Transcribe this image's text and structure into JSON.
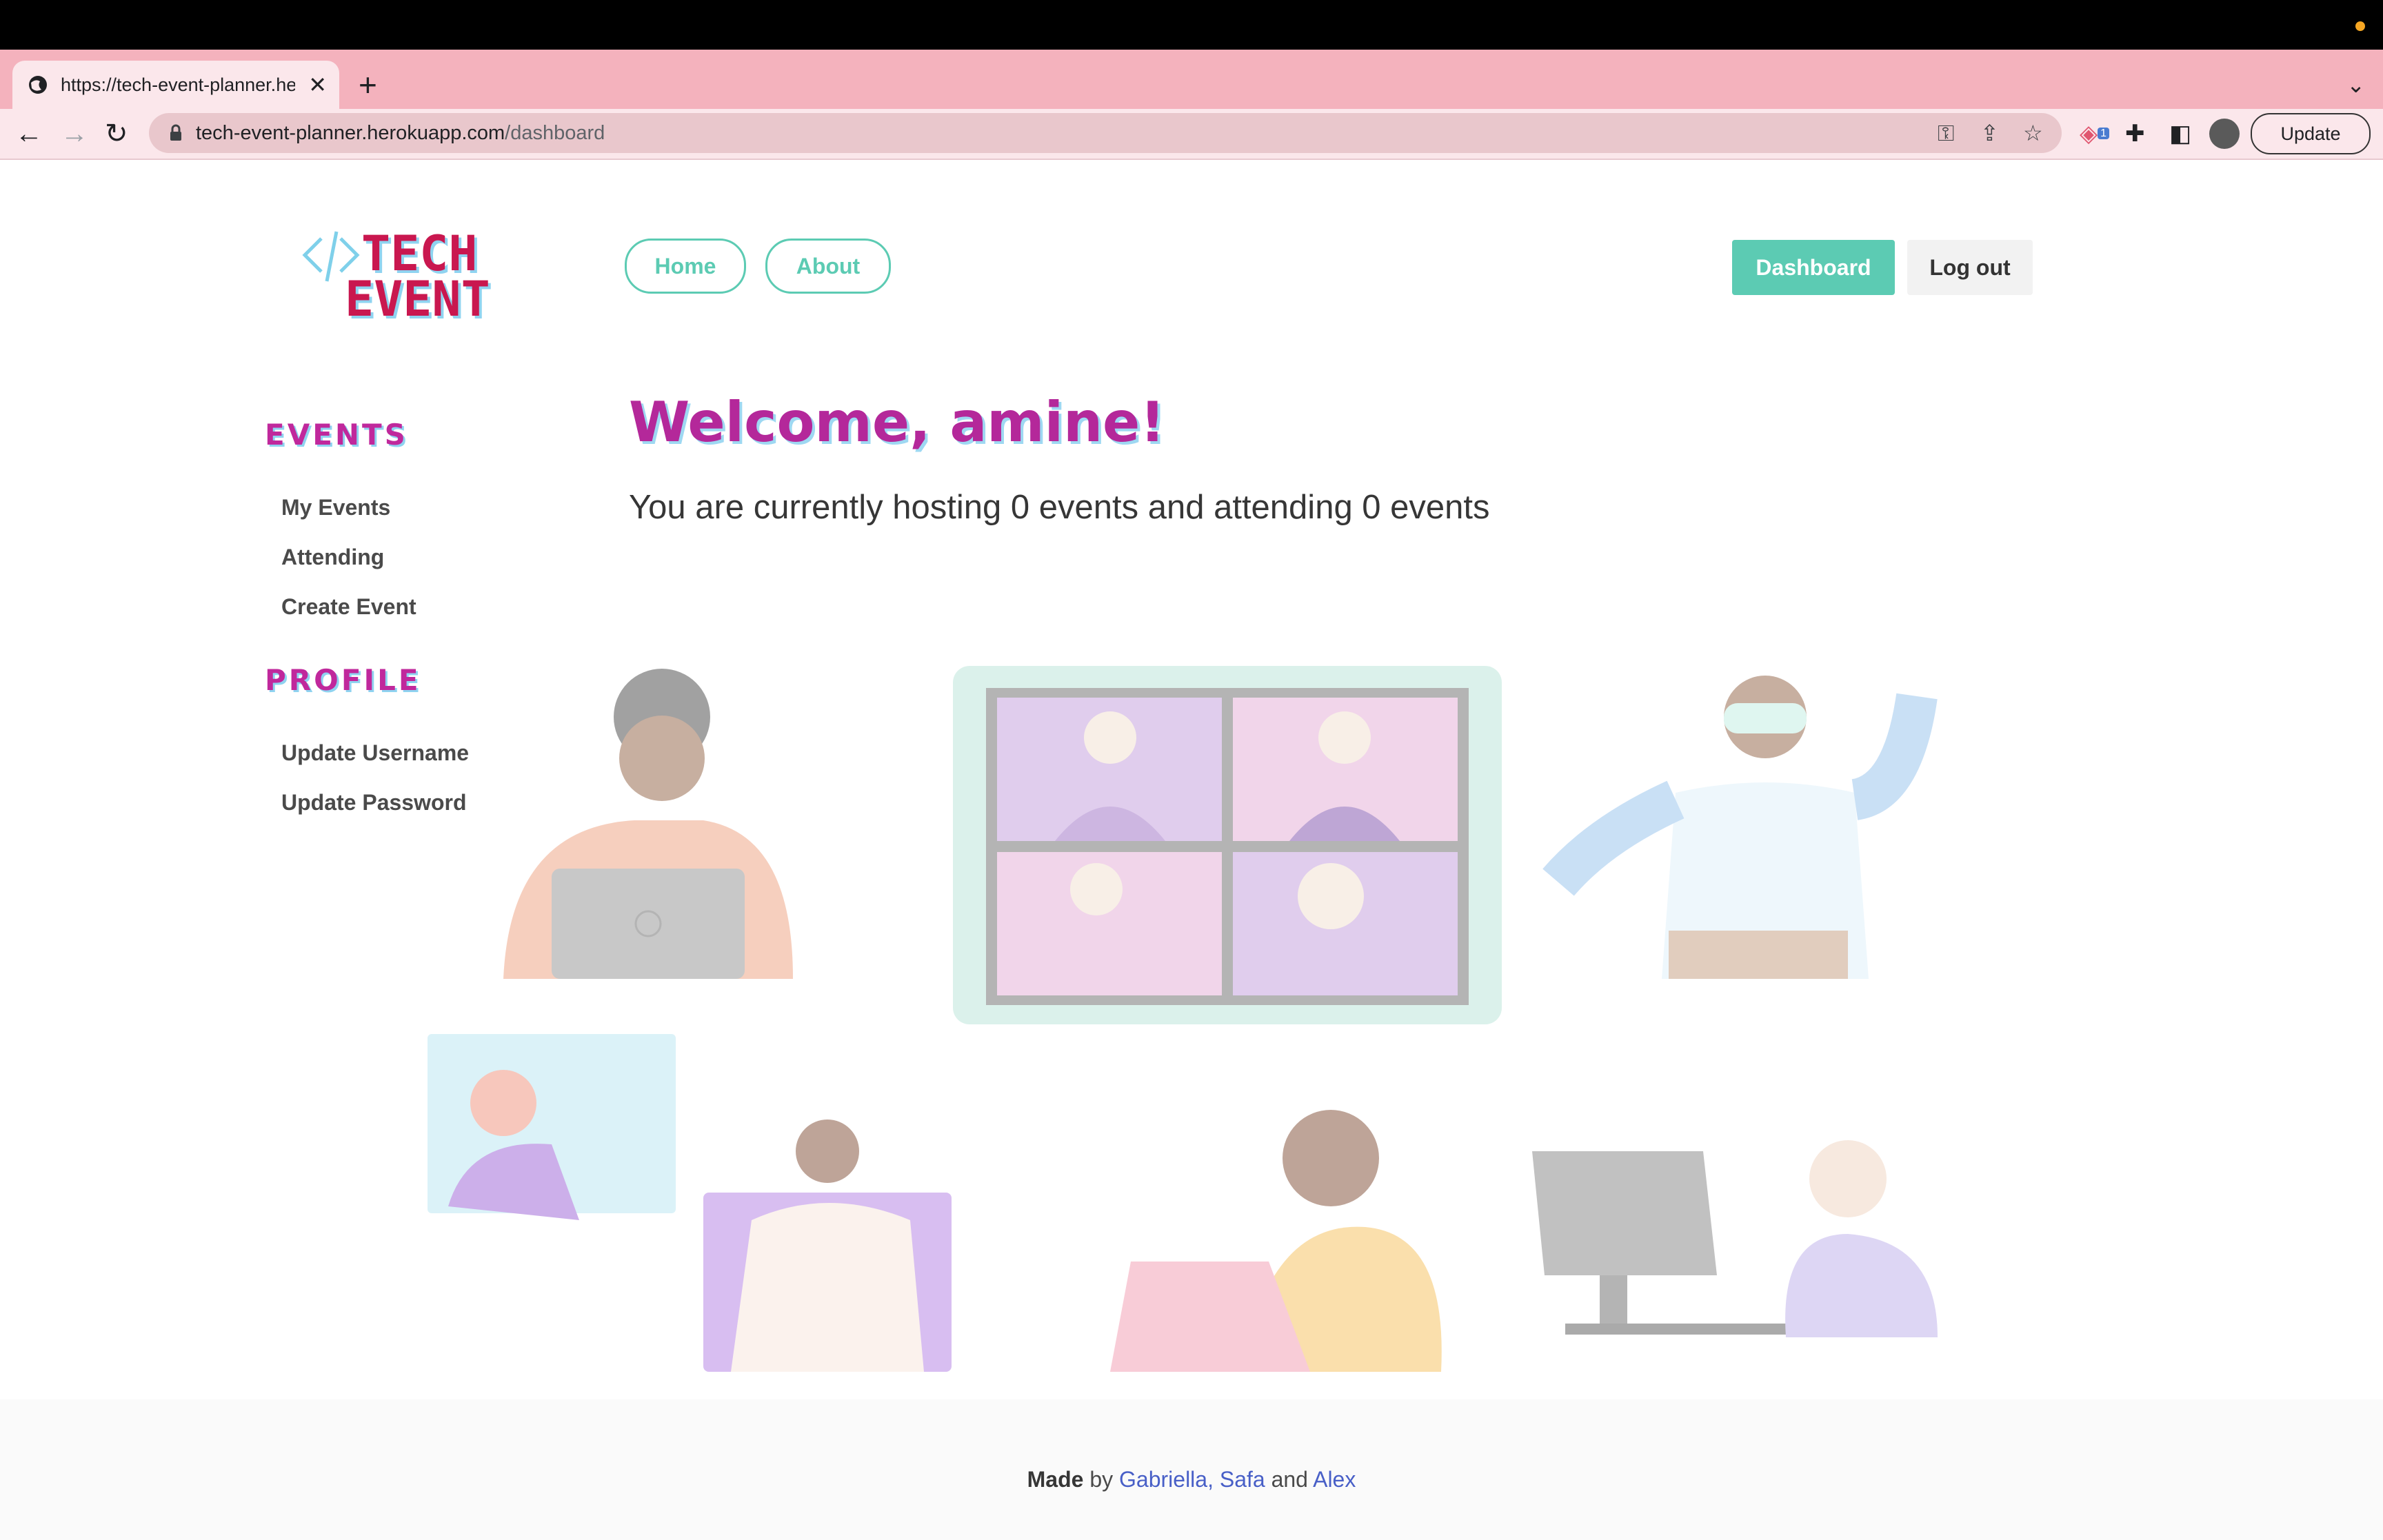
{
  "browser": {
    "tab_title": "https://tech-event-planner.herokuapp.com/dashboard",
    "new_tab_symbol": "+",
    "close_symbol": "✕",
    "url_domain": "tech-event-planner.herokuapp.com",
    "url_path": "/dashboard",
    "update_label": "Update",
    "extension_badge": "1"
  },
  "logo": {
    "line1": "TECH",
    "line2": "EVENT",
    "code_symbol": "</>"
  },
  "nav": {
    "home": "Home",
    "about": "About",
    "dashboard": "Dashboard",
    "logout": "Log out"
  },
  "sidebar": {
    "events_heading": "EVENTS",
    "events_links": [
      "My Events",
      "Attending",
      "Create Event"
    ],
    "profile_heading": "PROFILE",
    "profile_links": [
      "Update Username",
      "Update Password"
    ]
  },
  "main": {
    "welcome": "Welcome, amine!",
    "summary": "You are currently hosting 0 events and attending 0 events"
  },
  "footer": {
    "made": "Made",
    "by": " by ",
    "name1": "Gabriella,",
    "name2": "Safa",
    "and": " and ",
    "name3": "Alex"
  },
  "colors": {
    "accent": "#5ccbb3",
    "heading": "#b4289a",
    "tabstrip": "#f4b2bd"
  }
}
